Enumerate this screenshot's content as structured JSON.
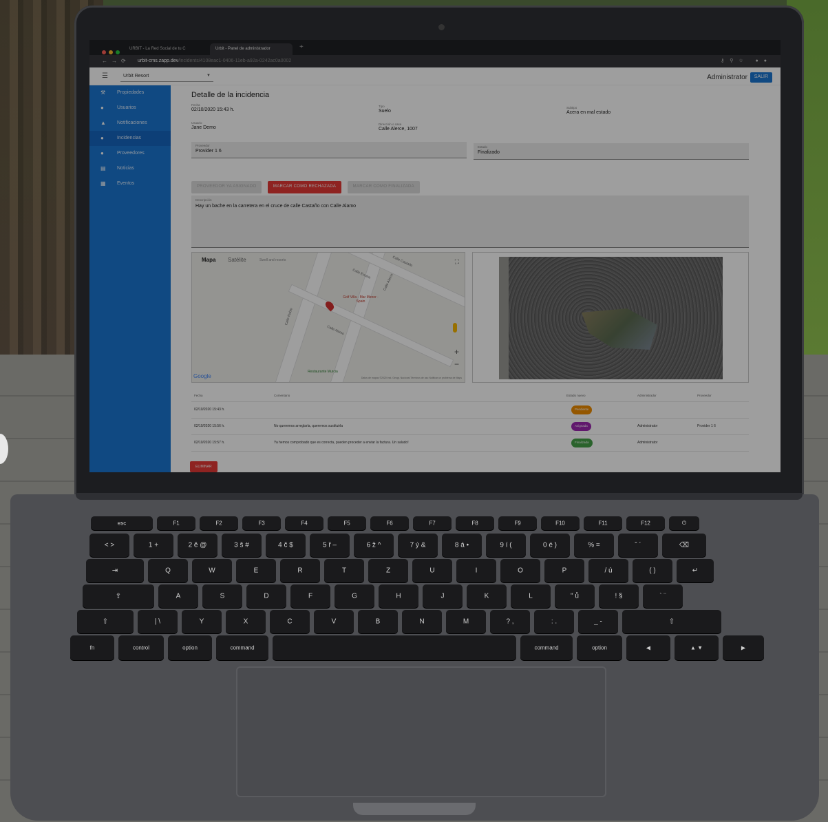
{
  "browser": {
    "tabs": [
      "URBIT - La Red Social de tu C",
      "Urbit - Panel de administrador"
    ],
    "url_host": "urbit-cms.zapp.dev",
    "url_path": "/incidents/4108eac1-0406-11eb-a92a-0242ac0a0002"
  },
  "topbar": {
    "resort": "Urbit Resort",
    "admin": "Administrator",
    "salir": "SALIR"
  },
  "sidebar": {
    "items": [
      {
        "label": "Propiedades",
        "icon": "tools-icon"
      },
      {
        "label": "Usuarios",
        "icon": "person-icon"
      },
      {
        "label": "Notificaciones",
        "icon": "bell-icon"
      },
      {
        "label": "Incidencias",
        "icon": "alert-icon"
      },
      {
        "label": "Proveedores",
        "icon": "provider-icon"
      },
      {
        "label": "Noticias",
        "icon": "news-icon"
      },
      {
        "label": "Eventos",
        "icon": "calendar-icon"
      }
    ],
    "active": 3
  },
  "detail": {
    "title": "Detalle de la incidencia",
    "fecha_label": "Fecha",
    "fecha": "02/10/2020 15:43 h.",
    "tipo_label": "Tipo",
    "tipo": "Suelo",
    "subtipo_label": "Subtipo",
    "subtipo": "Acera en mal estado",
    "usuario_label": "Usuario",
    "usuario": "Jane Demo",
    "direccion_label": "Dirección o casa",
    "direccion": "Calle Alerce, 1007",
    "proveedor_label": "Proveedor",
    "proveedor": "Provider 1 6",
    "estado_label": "Estado",
    "estado": "Finalizado",
    "descripcion_label": "Descripción",
    "descripcion": "Hay un bache en la carretera en el cruce de calle Castaño con Calle Alamo"
  },
  "buttons": {
    "asignar": "PROVEEDOR YA ASIGNADO",
    "rechazar": "MARCAR COMO RECHAZADA",
    "finalizar": "MARCAR COMO FINALIZADA",
    "eliminar": "ELIMINAR"
  },
  "map": {
    "tab_mapa": "Mapa",
    "tab_satelite": "Satélite",
    "poi": "Golf Villa - Mar Menor · Spain",
    "poi_small": "Swell and resorts",
    "poi_bottom": "Restaurante Murcia",
    "streets": [
      "Calle Encina",
      "Calle Alerce",
      "Calle Castaño",
      "Calle Alamo",
      "Calle Roble"
    ],
    "google": "Google",
    "copyright": "Datos de mapas ©2020 Inst. Geogr. Nacional   Términos de uso   Notificar un problema de Maps"
  },
  "history": {
    "headers": [
      "Fecha",
      "Comentario",
      "Estado nuevo",
      "Administrador",
      "Proveedor"
    ],
    "rows": [
      {
        "fecha": "02/10/2020 15:43 h.",
        "comentario": "",
        "estado": "Pendiente",
        "color": "#ef8c00",
        "admin": "",
        "proveedor": ""
      },
      {
        "fecha": "02/10/2020 15:56 h.",
        "comentario": "No queremos arreglarla, queremos sustituirla",
        "estado": "Asignada",
        "color": "#9c27b0",
        "admin": "Administrator",
        "proveedor": "Provider 1 6"
      },
      {
        "fecha": "02/10/2020 15:57 h.",
        "comentario": "Ya hemos comprobado que es correcta, pueden proceder a enviar la factura. Un saludo!",
        "estado": "Finalizada",
        "color": "#43a047",
        "admin": "Administrator",
        "proveedor": ""
      }
    ]
  },
  "keyboard": {
    "row1": [
      "esc",
      "F1",
      "F2",
      "F3",
      "F4",
      "F5",
      "F6",
      "F7",
      "F8",
      "F9",
      "F10",
      "F11",
      "F12",
      "⏻"
    ],
    "row2": [
      "< >",
      "1 +",
      "2 ě @",
      "3 š #",
      "4 č $",
      "5 ř –",
      "6 ž ^",
      "7 ý &",
      "8 á •",
      "9 í (",
      "0 é )",
      "% =",
      "ˇ ´",
      "⌫"
    ],
    "row3": [
      "⇥",
      "Q",
      "W",
      "E",
      "R",
      "T",
      "Z",
      "U",
      "I",
      "O",
      "P",
      "/ ú",
      "( )",
      "↵"
    ],
    "row4": [
      "⇪",
      "A",
      "S",
      "D",
      "F",
      "G",
      "H",
      "J",
      "K",
      "L",
      "\" ů",
      "! §",
      "` ¨"
    ],
    "row5": [
      "⇧",
      "| \\",
      "Y",
      "X",
      "C",
      "V",
      "B",
      "N",
      "M",
      "? ,",
      ": .",
      "_ -",
      "⇧"
    ],
    "row6": [
      "fn",
      "control",
      "option",
      "command",
      "",
      "command",
      "option",
      "◀",
      "▲ ▼",
      "▶"
    ]
  }
}
